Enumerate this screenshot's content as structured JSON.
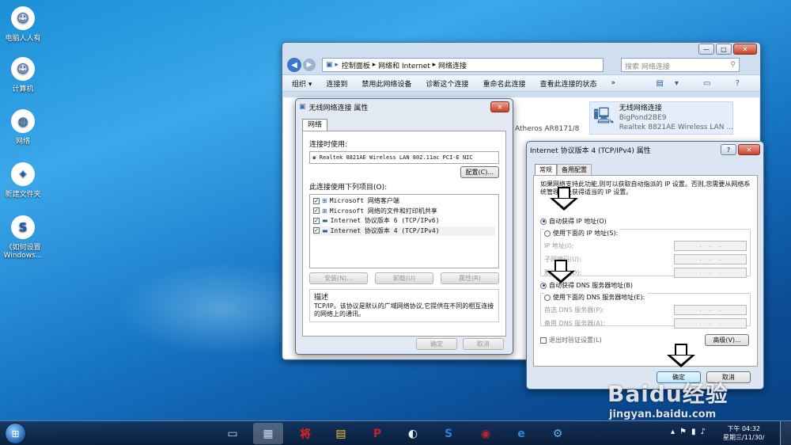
{
  "desktop": {
    "icons": [
      {
        "label": "电脑人人有",
        "glyph": "☺"
      },
      {
        "label": "计算机",
        "glyph": "☺"
      },
      {
        "label": "网络",
        "glyph": "◍"
      },
      {
        "label": "新建文件夹",
        "glyph": "✦"
      },
      {
        "label": "《如何设置 Windows...",
        "glyph": "S"
      }
    ]
  },
  "explorer": {
    "breadcrumb": [
      "控制面板",
      "网络和 Internet",
      "网络连接"
    ],
    "search_placeholder": "搜索 网络连接",
    "toolbar": [
      "组织 ▾",
      "连接到",
      "禁用此网络设备",
      "诊断这个连接",
      "重命名此连接",
      "查看此连接的状态",
      "»"
    ],
    "partial_adapter": "Atheros AR8171/8",
    "adapter": {
      "name": "无线网络连接",
      "network": "BigPond2BE9",
      "device": "Realtek 8821AE Wireless LAN ..."
    }
  },
  "props": {
    "title": "无线网络连接 属性",
    "tab": "网络",
    "connect_using_label": "连接时使用:",
    "device": "Realtek 8821AE Wireless LAN 802.11ac PCI-E NIC",
    "configure": "配置(C)...",
    "items_label": "此连接使用下列项目(O):",
    "items": [
      "Microsoft 网络客户端",
      "Microsoft 网络的文件和打印机共享",
      "Internet 协议版本 6 (TCP/IPv6)",
      "Internet 协议版本 4 (TCP/IPv4)"
    ],
    "install": "安装(N)...",
    "uninstall": "卸载(U)",
    "properties": "属性(R)",
    "desc_title": "描述",
    "desc_text": "TCP/IP。该协议是默认的广域网络协议,它提供在不同的相互连接的网络上的通讯。",
    "ok": "确定",
    "cancel": "取消"
  },
  "ipv4": {
    "title": "Internet 协议版本 4 (TCP/IPv4) 属性",
    "tabs": [
      "常规",
      "备用配置"
    ],
    "intro": "如果网络支持此功能,则可以获取自动指派的 IP 设置。否则,您需要从网络系统管理员处获得适当的 IP 设置。",
    "auto_ip": "自动获得 IP 地址(O)",
    "manual_ip": "使用下面的 IP 地址(S):",
    "ip_fields": [
      "IP 地址(I):",
      "子网掩码(U):",
      "默认网关(D):"
    ],
    "auto_dns": "自动获得 DNS 服务器地址(B)",
    "manual_dns": "使用下面的 DNS 服务器地址(E):",
    "dns_fields": [
      "首选 DNS 服务器(P):",
      "备用 DNS 服务器(A):"
    ],
    "validate": "退出时验证设置(L)",
    "advanced": "高级(V)...",
    "ok": "确定",
    "cancel": "取消"
  },
  "taskbar": {
    "apps": [
      "▭",
      "▦",
      "将",
      "▤",
      "P",
      "◐",
      "S",
      "◉",
      "e",
      "⚙"
    ],
    "clock_time": "下午 04:32",
    "clock_date": "星期三/11/30/"
  },
  "watermark": {
    "brand": "Baidu经验",
    "url": "jingyan.baidu.com"
  },
  "colors": {
    "accent": "#1d5fb0",
    "close": "#c5412a"
  }
}
